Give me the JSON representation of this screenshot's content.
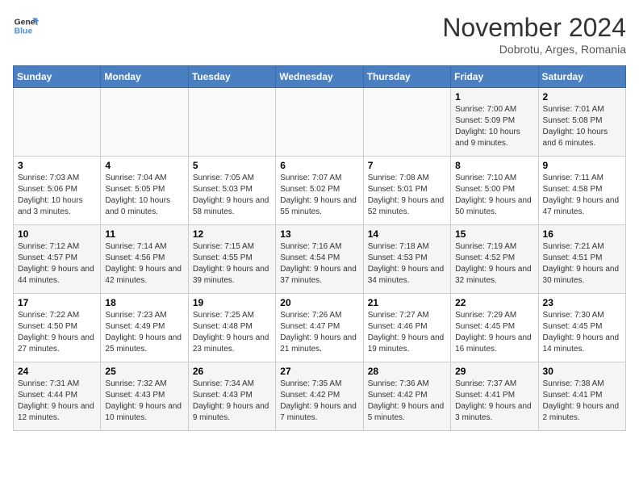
{
  "logo": {
    "line1": "General",
    "line2": "Blue"
  },
  "title": "November 2024",
  "subtitle": "Dobrotu, Arges, Romania",
  "days_of_week": [
    "Sunday",
    "Monday",
    "Tuesday",
    "Wednesday",
    "Thursday",
    "Friday",
    "Saturday"
  ],
  "weeks": [
    [
      {
        "day": "",
        "info": ""
      },
      {
        "day": "",
        "info": ""
      },
      {
        "day": "",
        "info": ""
      },
      {
        "day": "",
        "info": ""
      },
      {
        "day": "",
        "info": ""
      },
      {
        "day": "1",
        "info": "Sunrise: 7:00 AM\nSunset: 5:09 PM\nDaylight: 10 hours and 9 minutes."
      },
      {
        "day": "2",
        "info": "Sunrise: 7:01 AM\nSunset: 5:08 PM\nDaylight: 10 hours and 6 minutes."
      }
    ],
    [
      {
        "day": "3",
        "info": "Sunrise: 7:03 AM\nSunset: 5:06 PM\nDaylight: 10 hours and 3 minutes."
      },
      {
        "day": "4",
        "info": "Sunrise: 7:04 AM\nSunset: 5:05 PM\nDaylight: 10 hours and 0 minutes."
      },
      {
        "day": "5",
        "info": "Sunrise: 7:05 AM\nSunset: 5:03 PM\nDaylight: 9 hours and 58 minutes."
      },
      {
        "day": "6",
        "info": "Sunrise: 7:07 AM\nSunset: 5:02 PM\nDaylight: 9 hours and 55 minutes."
      },
      {
        "day": "7",
        "info": "Sunrise: 7:08 AM\nSunset: 5:01 PM\nDaylight: 9 hours and 52 minutes."
      },
      {
        "day": "8",
        "info": "Sunrise: 7:10 AM\nSunset: 5:00 PM\nDaylight: 9 hours and 50 minutes."
      },
      {
        "day": "9",
        "info": "Sunrise: 7:11 AM\nSunset: 4:58 PM\nDaylight: 9 hours and 47 minutes."
      }
    ],
    [
      {
        "day": "10",
        "info": "Sunrise: 7:12 AM\nSunset: 4:57 PM\nDaylight: 9 hours and 44 minutes."
      },
      {
        "day": "11",
        "info": "Sunrise: 7:14 AM\nSunset: 4:56 PM\nDaylight: 9 hours and 42 minutes."
      },
      {
        "day": "12",
        "info": "Sunrise: 7:15 AM\nSunset: 4:55 PM\nDaylight: 9 hours and 39 minutes."
      },
      {
        "day": "13",
        "info": "Sunrise: 7:16 AM\nSunset: 4:54 PM\nDaylight: 9 hours and 37 minutes."
      },
      {
        "day": "14",
        "info": "Sunrise: 7:18 AM\nSunset: 4:53 PM\nDaylight: 9 hours and 34 minutes."
      },
      {
        "day": "15",
        "info": "Sunrise: 7:19 AM\nSunset: 4:52 PM\nDaylight: 9 hours and 32 minutes."
      },
      {
        "day": "16",
        "info": "Sunrise: 7:21 AM\nSunset: 4:51 PM\nDaylight: 9 hours and 30 minutes."
      }
    ],
    [
      {
        "day": "17",
        "info": "Sunrise: 7:22 AM\nSunset: 4:50 PM\nDaylight: 9 hours and 27 minutes."
      },
      {
        "day": "18",
        "info": "Sunrise: 7:23 AM\nSunset: 4:49 PM\nDaylight: 9 hours and 25 minutes."
      },
      {
        "day": "19",
        "info": "Sunrise: 7:25 AM\nSunset: 4:48 PM\nDaylight: 9 hours and 23 minutes."
      },
      {
        "day": "20",
        "info": "Sunrise: 7:26 AM\nSunset: 4:47 PM\nDaylight: 9 hours and 21 minutes."
      },
      {
        "day": "21",
        "info": "Sunrise: 7:27 AM\nSunset: 4:46 PM\nDaylight: 9 hours and 19 minutes."
      },
      {
        "day": "22",
        "info": "Sunrise: 7:29 AM\nSunset: 4:45 PM\nDaylight: 9 hours and 16 minutes."
      },
      {
        "day": "23",
        "info": "Sunrise: 7:30 AM\nSunset: 4:45 PM\nDaylight: 9 hours and 14 minutes."
      }
    ],
    [
      {
        "day": "24",
        "info": "Sunrise: 7:31 AM\nSunset: 4:44 PM\nDaylight: 9 hours and 12 minutes."
      },
      {
        "day": "25",
        "info": "Sunrise: 7:32 AM\nSunset: 4:43 PM\nDaylight: 9 hours and 10 minutes."
      },
      {
        "day": "26",
        "info": "Sunrise: 7:34 AM\nSunset: 4:43 PM\nDaylight: 9 hours and 9 minutes."
      },
      {
        "day": "27",
        "info": "Sunrise: 7:35 AM\nSunset: 4:42 PM\nDaylight: 9 hours and 7 minutes."
      },
      {
        "day": "28",
        "info": "Sunrise: 7:36 AM\nSunset: 4:42 PM\nDaylight: 9 hours and 5 minutes."
      },
      {
        "day": "29",
        "info": "Sunrise: 7:37 AM\nSunset: 4:41 PM\nDaylight: 9 hours and 3 minutes."
      },
      {
        "day": "30",
        "info": "Sunrise: 7:38 AM\nSunset: 4:41 PM\nDaylight: 9 hours and 2 minutes."
      }
    ]
  ]
}
